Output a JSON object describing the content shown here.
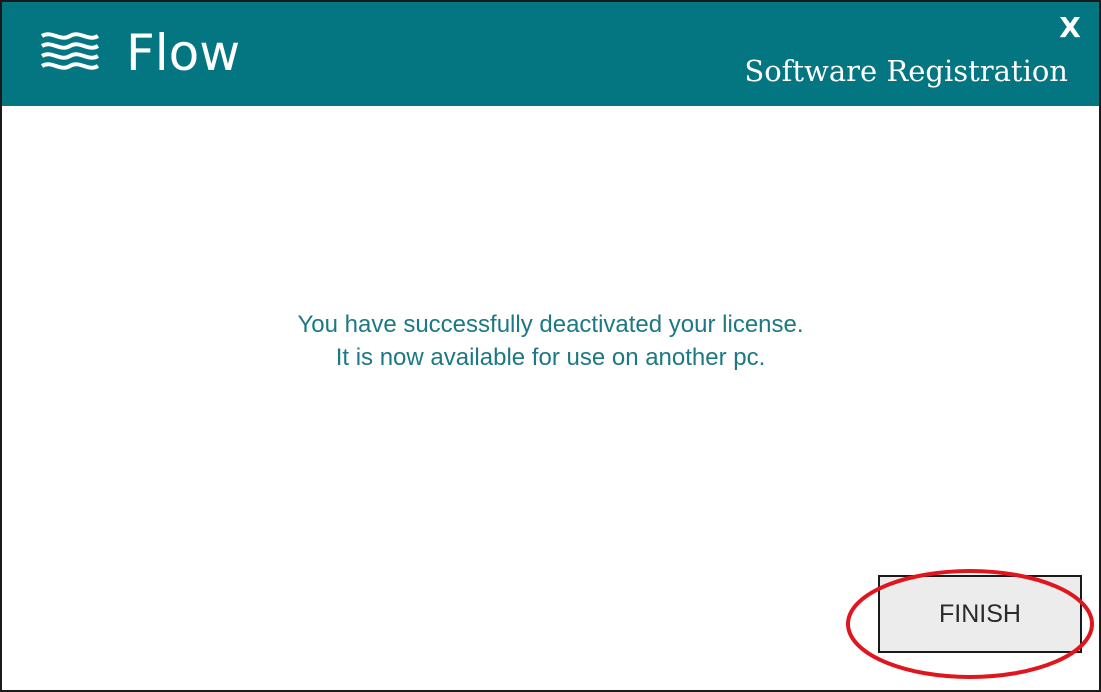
{
  "header": {
    "brand": "Flow",
    "subtitle": "Software Registration",
    "close_label": "X",
    "logo_icon": "flow-wave-logo-icon",
    "background_color": "#037681"
  },
  "message": {
    "line1": "You have successfully deactivated your license.",
    "line2": "It is now available for use on another pc.",
    "color": "#1c7983"
  },
  "actions": {
    "finish_label": "FINISH"
  },
  "annotation": {
    "shape": "ellipse",
    "color": "#e0161f",
    "target": "finish-button"
  }
}
